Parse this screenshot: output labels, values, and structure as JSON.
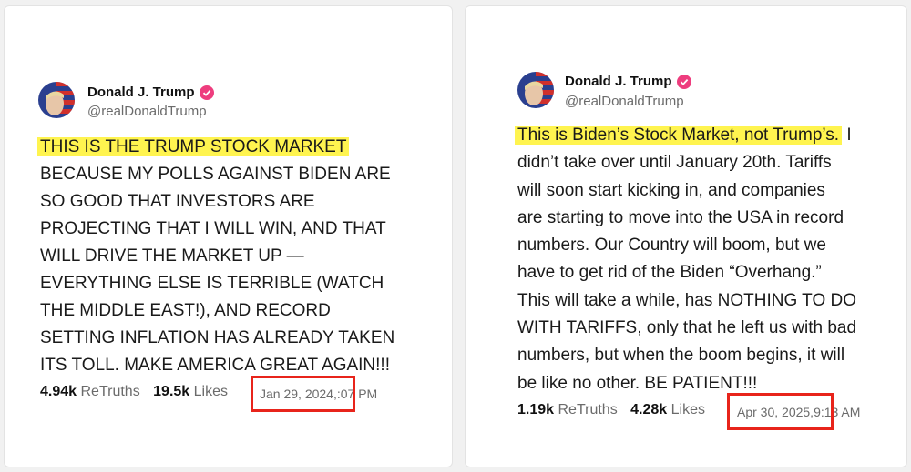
{
  "colors": {
    "highlight": "#fff44f",
    "annotation_box": "#e8241b",
    "verified_badge": "#ee3d7e"
  },
  "posts": [
    {
      "author_name": "Donald J. Trump",
      "handle": "@realDonaldTrump",
      "verified_icon": "verified-badge-icon",
      "highlighted_text": "THIS IS THE TRUMP STOCK MARKET",
      "lines": [
        "BECAUSE MY POLLS AGAINST BIDEN ARE",
        "SO GOOD THAT INVESTORS ARE",
        "PROJECTING THAT I WILL WIN, AND THAT",
        "WILL DRIVE THE MARKET UP —",
        "EVERYTHING ELSE IS TERRIBLE (WATCH",
        "THE MIDDLE EAST!), AND RECORD",
        "SETTING INFLATION HAS ALREADY TAKEN",
        "ITS TOLL. MAKE AMERICA GREAT AGAIN!!!"
      ],
      "retruths_count": "4.94k",
      "retruths_label": "ReTruths",
      "likes_count": "19.5k",
      "likes_label": "Likes",
      "date": "Jan 29, 2024,",
      "time": ":07 PM"
    },
    {
      "author_name": "Donald J. Trump",
      "handle": "@realDonaldTrump",
      "verified_icon": "verified-badge-icon",
      "highlighted_text": "This is Biden’s Stock Market, not Trump’s.",
      "first_line_rest": " I",
      "lines": [
        "didn’t take over until January 20th. Tariffs",
        "will soon start kicking in, and companies",
        "are starting to move into the USA in record",
        "numbers. Our Country will boom, but we",
        "have to get rid of the Biden “Overhang.”",
        "This will take a while, has NOTHING TO DO",
        "WITH TARIFFS, only that he left us with bad",
        "numbers, but when the boom begins, it will",
        "be like no other. BE PATIENT!!!"
      ],
      "retruths_count": "1.19k",
      "retruths_label": "ReTruths",
      "likes_count": "4.28k",
      "likes_label": "Likes",
      "date": "Apr 30, 2025,",
      "time": "9:13 AM"
    }
  ]
}
